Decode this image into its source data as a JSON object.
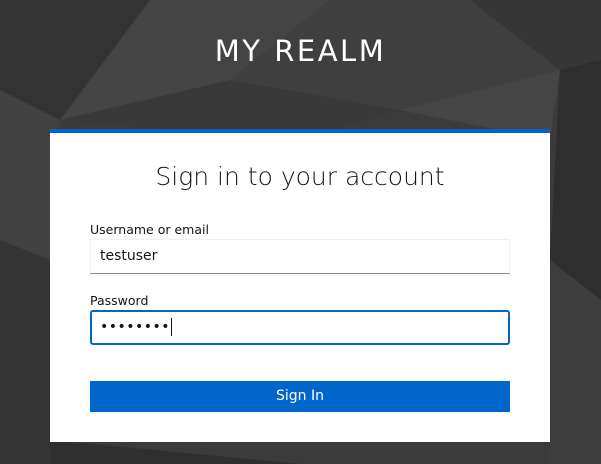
{
  "realm": {
    "title": "MY REALM"
  },
  "login": {
    "heading": "Sign in to your account",
    "username_label": "Username or email",
    "username_value": "testuser",
    "password_label": "Password",
    "password_value": "••••••••",
    "submit_label": "Sign In"
  },
  "colors": {
    "accent": "#0066cc",
    "background": "#3a3a3a",
    "card": "#ffffff"
  }
}
